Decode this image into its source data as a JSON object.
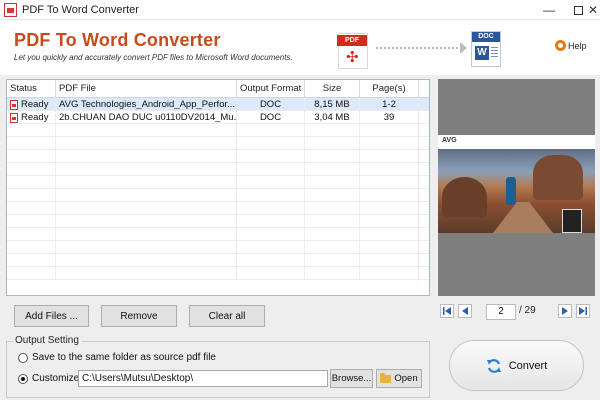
{
  "window": {
    "title": "PDF To Word Converter"
  },
  "header": {
    "app_title": "PDF To Word Converter",
    "subtitle": "Let you quickly and accurately convert PDF files to Microsoft Word documents.",
    "source_badge": "PDF",
    "target_badge": "DOC",
    "help_label": "Help"
  },
  "file_table": {
    "columns": [
      "Status",
      "PDF File",
      "Output Format",
      "Size",
      "Page(s)"
    ],
    "rows": [
      {
        "status": "Ready",
        "file": "AVG Technologies_Android_App_Perfor...",
        "format": "DOC",
        "size": "8,15 MB",
        "pages": "1-2",
        "selected": true
      },
      {
        "status": "Ready",
        "file": "2b.CHUAN DAO DUC u0110DV2014_Mu...",
        "format": "DOC",
        "size": "3,04 MB",
        "pages": "39",
        "selected": false
      }
    ]
  },
  "buttons": {
    "add_files": "Add Files ...",
    "remove": "Remove",
    "clear_all": "Clear all",
    "browse": "Browse...",
    "open": "Open",
    "convert": "Convert"
  },
  "preview": {
    "brand_text": "AVG",
    "current_page": "2",
    "total_pages": "/ 29"
  },
  "output_setting": {
    "legend": "Output Setting",
    "option_same_folder": "Save to the same folder as source pdf file",
    "option_customize": "Customize",
    "selected_option": "customize",
    "path": "C:\\Users\\Mutsu\\Desktop\\"
  },
  "colors": {
    "title_orange": "#c84b1e",
    "pdf_red": "#d52b1e",
    "word_blue": "#2b579a",
    "selection": "#dce9f8"
  }
}
